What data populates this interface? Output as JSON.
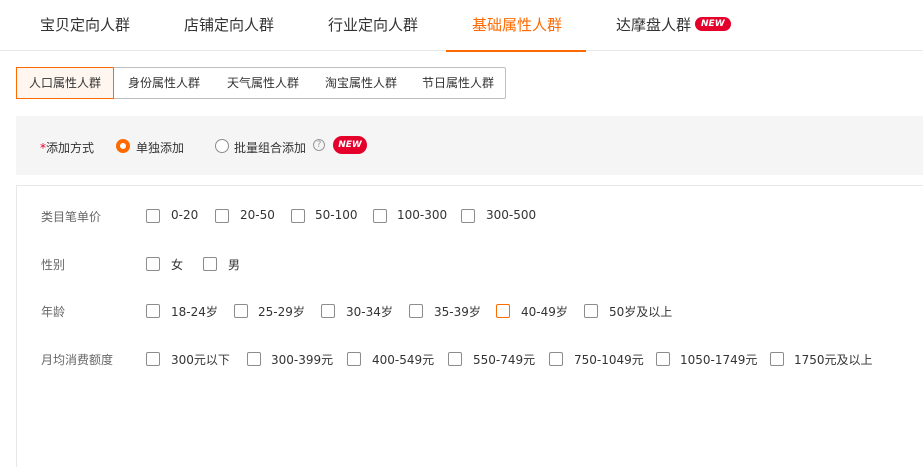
{
  "top_tabs": [
    {
      "label": "宝贝定向人群"
    },
    {
      "label": "店铺定向人群"
    },
    {
      "label": "行业定向人群"
    },
    {
      "label": "基础属性人群"
    },
    {
      "label": "达摩盘人群",
      "badge": "NEW"
    }
  ],
  "active_top_tab": "基础属性人群",
  "sub_tabs": [
    "人口属性人群",
    "身份属性人群",
    "天气属性人群",
    "淘宝属性人群",
    "节日属性人群"
  ],
  "active_sub_tab": "人口属性人群",
  "add_method": {
    "required_mark": "*",
    "label": "添加方式",
    "options": [
      "单独添加",
      "批量组合添加"
    ],
    "selected": "单独添加",
    "help_glyph": "?",
    "badge": "NEW"
  },
  "attributes": [
    {
      "label": "类目笔单价",
      "options": [
        "0-20",
        "20-50",
        "50-100",
        "100-300",
        "300-500"
      ]
    },
    {
      "label": "性别",
      "options": [
        "女",
        "男"
      ]
    },
    {
      "label": "年龄",
      "options": [
        "18-24岁",
        "25-29岁",
        "30-34岁",
        "35-39岁",
        "40-49岁",
        "50岁及以上"
      ]
    },
    {
      "label": "月均消费额度",
      "options": [
        "300元以下",
        "300-399元",
        "400-549元",
        "550-749元",
        "750-1049元",
        "1050-1749元",
        "1750元及以上"
      ]
    }
  ],
  "colors": {
    "accent": "#ff6a00",
    "badge": "#e4002b",
    "bar_bg": "#f5f5f5"
  }
}
